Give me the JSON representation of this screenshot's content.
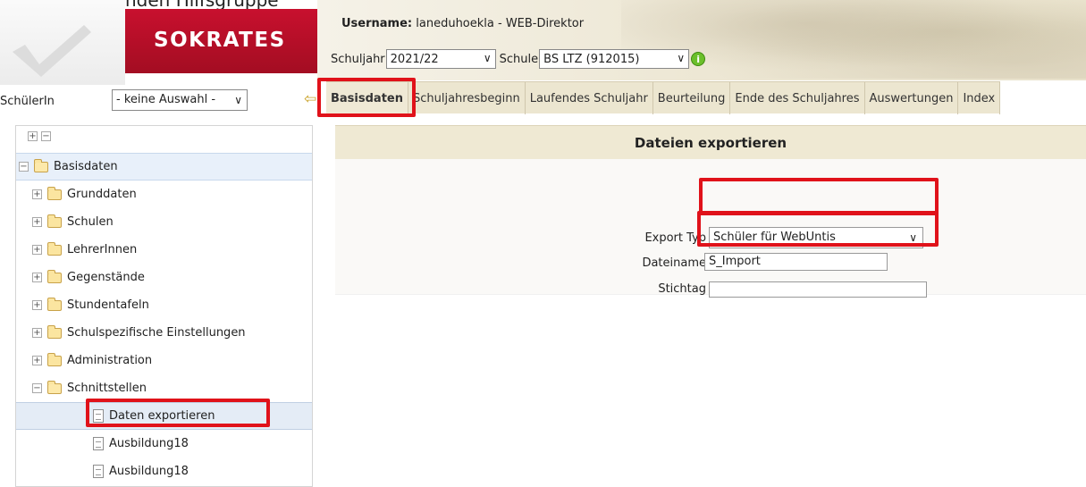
{
  "overlay": {
    "cut_text": "er passenden Hilfsgruppe"
  },
  "brand": {
    "name": "SOKRATES"
  },
  "user": {
    "label": "Username:",
    "value": "laneduhoekla - WEB-Direktor"
  },
  "school": {
    "year_label": "Schuljahr",
    "year_value": "2021/22",
    "school_label": "Schule",
    "school_value": "BS LTZ (912015)",
    "info_icon": "info-icon"
  },
  "student": {
    "label": "SchülerIn",
    "value": "- keine Auswahl -"
  },
  "tabs": [
    {
      "label": "Basisdaten",
      "active": true
    },
    {
      "label": "Schuljahresbeginn"
    },
    {
      "label": "Laufendes Schuljahr"
    },
    {
      "label": "Beurteilung"
    },
    {
      "label": "Ende des Schuljahres"
    },
    {
      "label": "Auswertungen"
    },
    {
      "label": "Index"
    }
  ],
  "tree": {
    "expand_all": "+",
    "collapse_all": "−",
    "root": "Basisdaten",
    "items": [
      "Grunddaten",
      "Schulen",
      "LehrerInnen",
      "Gegenstände",
      "Stundentafeln",
      "Schulspezifische Einstellungen",
      "Administration",
      "Schnittstellen"
    ],
    "children": [
      "Daten exportieren",
      "Ausbildung18",
      "Ausbildung18"
    ]
  },
  "main": {
    "title": "Dateien exportieren",
    "export_type_label": "Export Typ",
    "export_type_value": "Schüler für WebUntis",
    "filename_label": "Dateiname",
    "filename_value": "S_Import",
    "stichtag_label": "Stichtag",
    "stichtag_value": ""
  },
  "colors": {
    "highlight": "#e0121a",
    "brand": "#c8102e",
    "tab_bg": "#ece6d0"
  }
}
